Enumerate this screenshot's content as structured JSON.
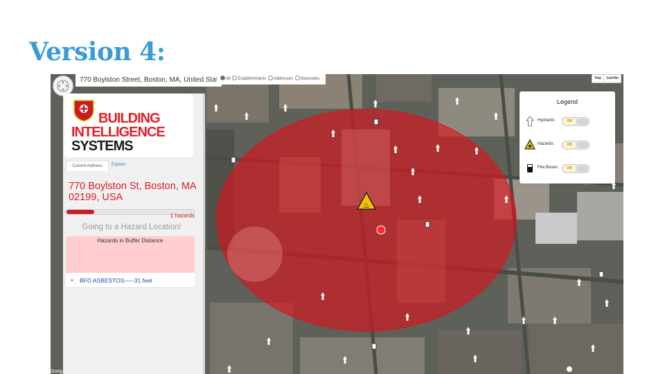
{
  "slide_title": "Version 4:",
  "map": {
    "address_bar": "770 Boylston Street, Boston, MA, United States",
    "search_filter": {
      "options": [
        "All",
        "Establishments",
        "Addresses",
        "Geocodes"
      ],
      "selected": "All"
    },
    "map_type": [
      "Map",
      "Satellite"
    ],
    "google_mark": "Goog"
  },
  "panel": {
    "logo": {
      "seal_text": "BOSTON FIRE",
      "line1": "BUILDING",
      "line2": "INTELLIGENCE",
      "line3": "SYSTEMS"
    },
    "tabs": [
      "Current Address",
      "Explore"
    ],
    "current_address": "770 Boylston St, Boston, MA 02199, USA",
    "progress": 0.22,
    "hazard_count": "1 hazards",
    "going_to": "Going to a Hazard Location!",
    "buffer_header": "Hazards in Buffer Distance",
    "hazard_items": [
      "BFD ASBESTOS-----31 feet"
    ]
  },
  "legend": {
    "title": "Legend",
    "rows": [
      {
        "label": "Hydrants:",
        "toggle": "ON",
        "icon": "hydrant-icon"
      },
      {
        "label": "Hazards:",
        "toggle": "ON",
        "icon": "hazard-icon"
      },
      {
        "label": "Fire Boxes:",
        "toggle": "ON",
        "icon": "fire-box-icon"
      }
    ]
  },
  "colors": {
    "title_blue": "#3a9bd5",
    "brand_red": "#e2202b",
    "buffer_red": "#e0101a",
    "link_blue": "#1b4f9c"
  }
}
